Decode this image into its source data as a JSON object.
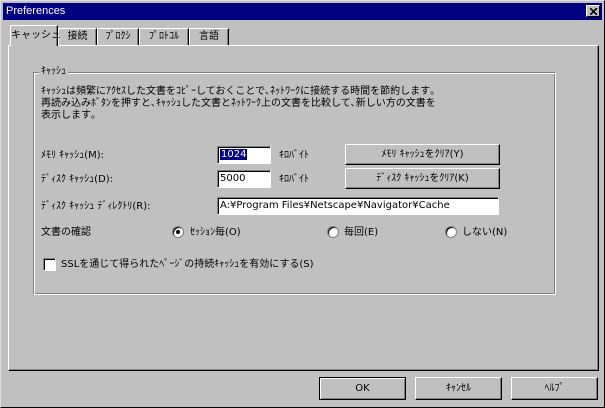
{
  "window": {
    "title": "Preferences"
  },
  "tabs": [
    {
      "label": "キャッシュ",
      "active": true
    },
    {
      "label": "接続",
      "active": false
    },
    {
      "label": "ﾌﾟﾛｸｼ",
      "active": false
    },
    {
      "label": "ﾌﾟﾛﾄｺﾙ",
      "active": false
    },
    {
      "label": "言語",
      "active": false
    }
  ],
  "cache": {
    "group_label": "ｷｬｯｼｭ",
    "description": [
      "ｷｬｯｼｭは頻繁にｱｸｾｽした文書をｺﾋﾟｰしておくことで､ﾈｯﾄﾜｰｸに接続する時間を節約します｡",
      "再読み込みﾎﾞﾀﾝを押すと､ｷｬｯｼｭした文書とﾈｯﾄﾜｰｸ上の文書を比較して､新しい方の文書を",
      "表示します｡"
    ],
    "memory_label": "ﾒﾓﾘ ｷｬｯｼｭ(M):",
    "memory_value": "1024",
    "memory_unit": "ｷﾛﾊﾞｲﾄ",
    "clear_memory_button": "ﾒﾓﾘ ｷｬｯｼｭをｸﾘｱ(Y)",
    "disk_label": "ﾃﾞｨｽｸ ｷｬｯｼｭ(D):",
    "disk_value": "5000",
    "disk_unit": "ｷﾛﾊﾞｲﾄ",
    "clear_disk_button": "ﾃﾞｨｽｸ ｷｬｯｼｭをｸﾘｱ(K)",
    "directory_label": "ﾃﾞｨｽｸ ｷｬｯｼｭ ﾃﾞｨﾚｸﾄﾘ(R):",
    "directory_value": "A:¥Program Files¥Netscape¥Navigator¥Cache",
    "verify_label": "文書の確認",
    "verify_options": [
      {
        "label": "ｾｯｼｮﾝ毎(O)",
        "selected": true
      },
      {
        "label": "毎回(E)",
        "selected": false
      },
      {
        "label": "しない(N)",
        "selected": false
      }
    ],
    "ssl_checkbox_label": "SSLを通じて得られたﾍﾟｰｼﾞの持続ｷｬｯｼｭを有効にする(S)",
    "ssl_checked": false
  },
  "footer": {
    "ok_label": "OK",
    "cancel_label": "ｷｬﾝｾﾙ",
    "help_label": "ﾍﾙﾌﾟ"
  }
}
